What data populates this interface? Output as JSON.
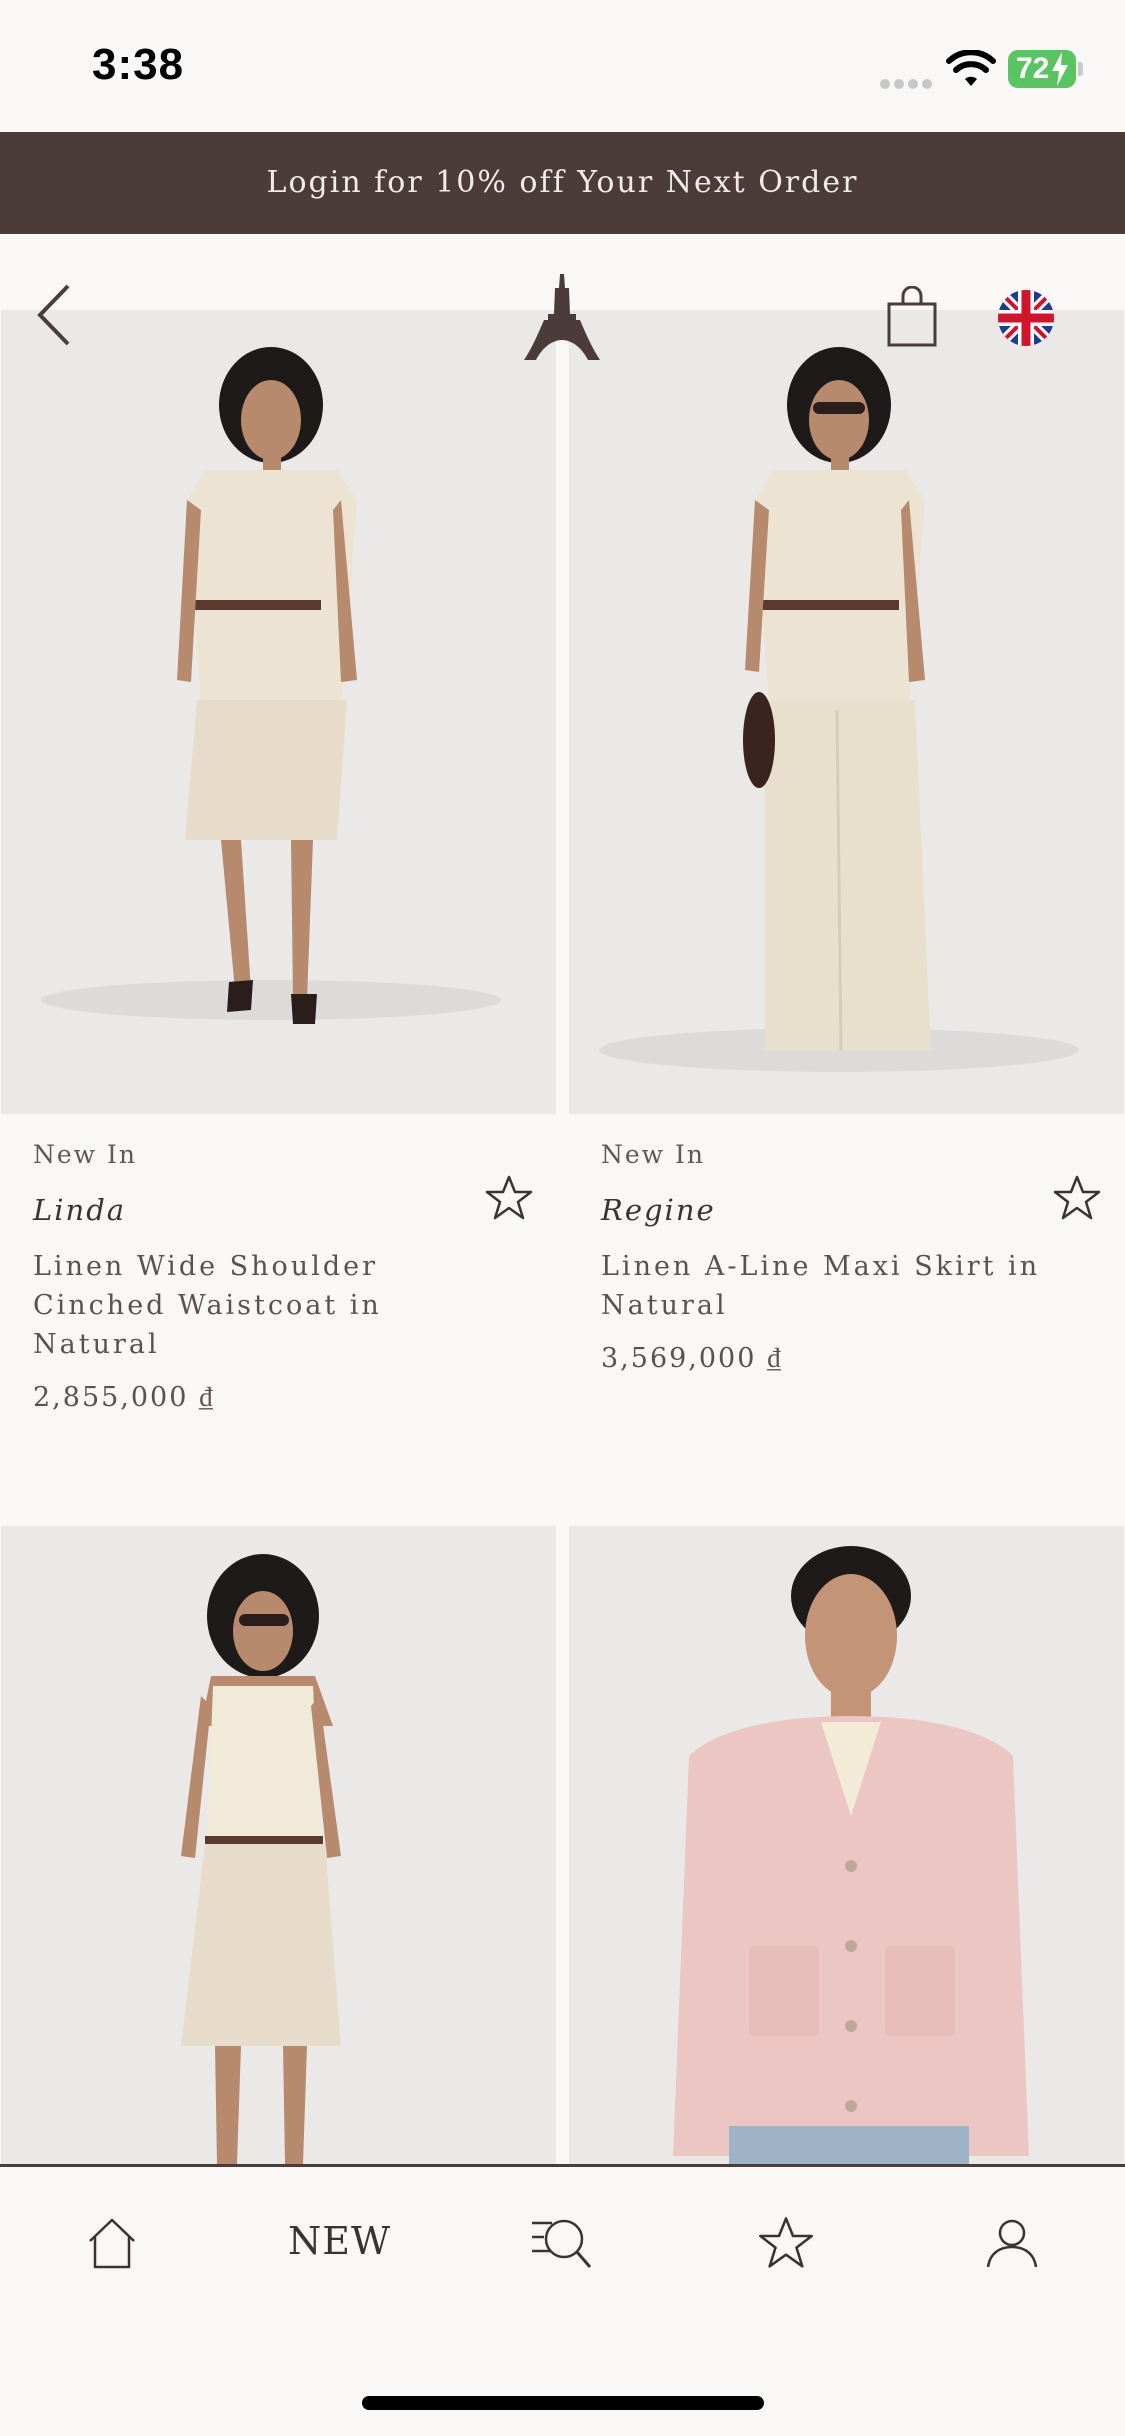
{
  "status_bar": {
    "time": "3:38",
    "battery": "72"
  },
  "promo": {
    "text": "Login for 10% off Your Next Order"
  },
  "header": {
    "back_icon": "chevron-left-icon",
    "logo_icon": "eiffel-tower-logo-icon",
    "bag_icon": "shopping-bag-icon",
    "language_icon": "uk-flag-icon"
  },
  "products": [
    {
      "tag": "New In",
      "brand": "Linda",
      "title": "Linen Wide Shoulder Cinched Waistcoat in Natural",
      "price": "2,855,000 ₫"
    },
    {
      "tag": "New In",
      "brand": "Regine",
      "title": "Linen A-Line Maxi Skirt in Natural",
      "price": "3,569,000 ₫"
    },
    {
      "tag": "",
      "brand": "",
      "title": "",
      "price": ""
    },
    {
      "tag": "",
      "brand": "",
      "title": "",
      "price": ""
    }
  ],
  "tab_bar": {
    "home_icon": "home-icon",
    "new_label": "NEW",
    "search_icon": "search-list-icon",
    "favorites_icon": "star-icon",
    "account_icon": "user-icon"
  },
  "colors": {
    "brand_dark": "#4b3c3a",
    "background": "#f9f8f6",
    "image_bg": "#eae9e8",
    "battery_green": "#5ac462"
  }
}
